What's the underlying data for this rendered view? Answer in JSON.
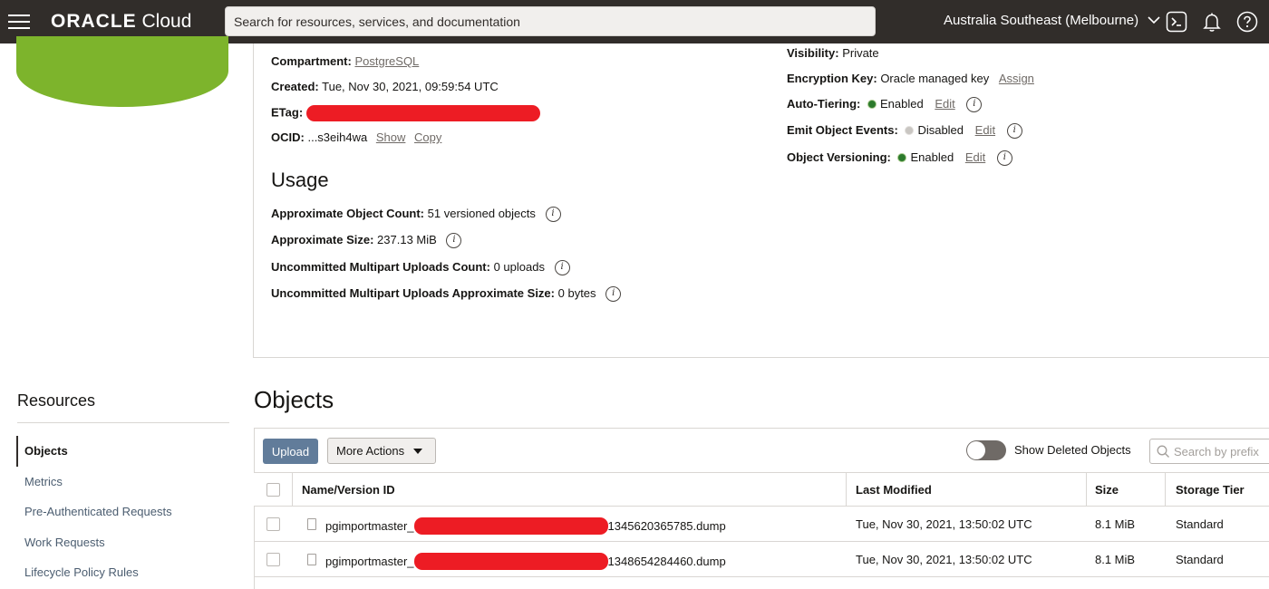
{
  "topbar": {
    "brand_primary": "ORACLE",
    "brand_secondary": "Cloud",
    "search_placeholder": "Search for resources, services, and documentation",
    "region": "Australia Southeast (Melbourne)"
  },
  "details": {
    "compartment_label": "Compartment:",
    "compartment_value": "PostgreSQL",
    "created_label": "Created:",
    "created_value": "Tue, Nov 30, 2021, 09:59:54 UTC",
    "etag_label": "ETag:",
    "ocid_label": "OCID:",
    "ocid_value": "...s3eih4wa",
    "show_link": "Show",
    "copy_link": "Copy",
    "visibility_label": "Visibility:",
    "visibility_value": "Private",
    "encryption_label": "Encryption Key:",
    "encryption_value": "Oracle managed key",
    "assign_link": "Assign",
    "autotier_label": "Auto-Tiering:",
    "autotier_value": "Enabled",
    "emit_label": "Emit Object Events:",
    "emit_value": "Disabled",
    "versioning_label": "Object Versioning:",
    "versioning_value": "Enabled",
    "edit_link": "Edit"
  },
  "usage": {
    "title": "Usage",
    "count_label": "Approximate Object Count:",
    "count_value": "51 versioned objects",
    "size_label": "Approximate Size:",
    "size_value": "237.13 MiB",
    "mp_count_label": "Uncommitted Multipart Uploads Count:",
    "mp_count_value": "0 uploads",
    "mp_size_label": "Uncommitted Multipart Uploads Approximate Size:",
    "mp_size_value": "0 bytes"
  },
  "resources": {
    "title": "Resources",
    "items": [
      "Objects",
      "Metrics",
      "Pre-Authenticated Requests",
      "Work Requests",
      "Lifecycle Policy Rules"
    ]
  },
  "objects": {
    "title": "Objects",
    "upload_label": "Upload",
    "more_actions_label": "More Actions",
    "show_deleted_label": "Show Deleted Objects",
    "show_deleted_on": false,
    "search_placeholder": "Search by prefix",
    "columns": [
      "Name/Version ID",
      "Last Modified",
      "Size",
      "Storage Tier"
    ],
    "rows": [
      {
        "name_prefix": "pgimportmaster_",
        "name_suffix": "1345620365785.dump",
        "modified": "Tue, Nov 30, 2021, 13:50:02 UTC",
        "size": "8.1 MiB",
        "tier": "Standard"
      },
      {
        "name_prefix": "pgimportmaster_",
        "name_suffix": "1348654284460.dump",
        "modified": "Tue, Nov 30, 2021, 13:50:02 UTC",
        "size": "8.1 MiB",
        "tier": "Standard"
      }
    ]
  },
  "colors": {
    "topbar": "#312d2a",
    "upload_button": "#617c9a",
    "bucket_icon": "#7db42c",
    "redaction": "#ed1c24"
  }
}
